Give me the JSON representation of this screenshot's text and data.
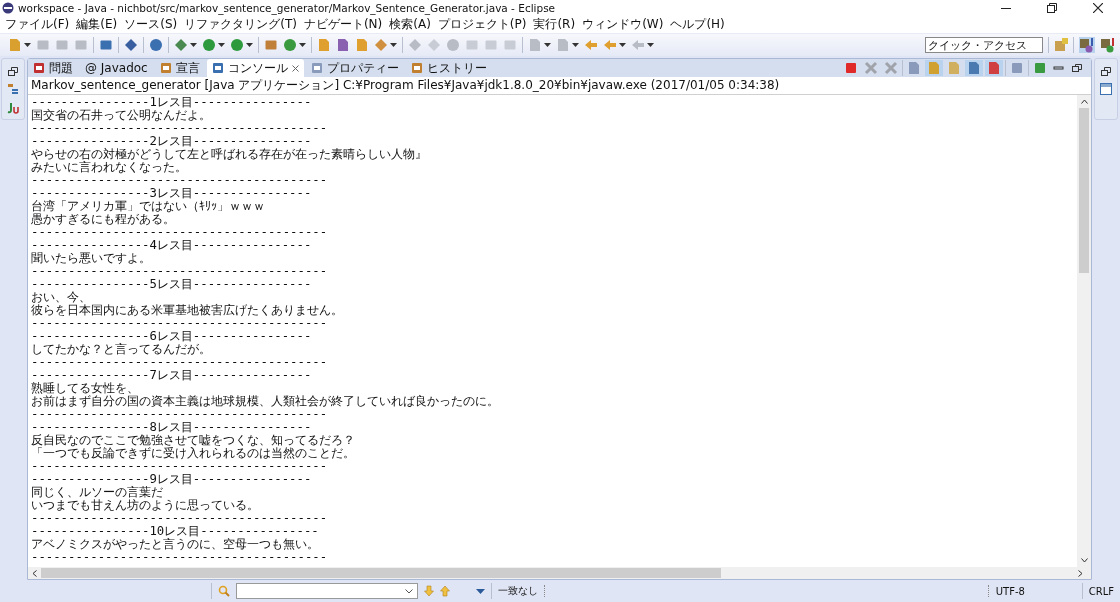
{
  "window": {
    "title": "workspace - Java - nichbot/src/markov_sentence_generator/Markov_Sentence_Generator.java - Eclipse"
  },
  "menu": [
    "ファイル(F)",
    "編集(E)",
    "ソース(S)",
    "リファクタリング(T)",
    "ナビゲート(N)",
    "検索(A)",
    "プロジェクト(P)",
    "実行(R)",
    "ウィンドウ(W)",
    "ヘルプ(H)"
  ],
  "quick_access": {
    "placeholder": "クイック・アクセス"
  },
  "tabs": [
    {
      "label": "問題",
      "selected": false
    },
    {
      "label": "@ Javadoc",
      "selected": false
    },
    {
      "label": "宣言",
      "selected": false
    },
    {
      "label": "コンソール",
      "selected": true
    },
    {
      "label": "プロパティー",
      "selected": false
    },
    {
      "label": "ヒストリー",
      "selected": false
    }
  ],
  "console": {
    "header": "Markov_sentence_generator [Java アプリケーション] C:¥Program Files¥Java¥jdk1.8.0_20¥bin¥javaw.exe (2017/01/05 0:34:38)",
    "lines": [
      "----------------1レス目----------------",
      "国交省の石井って公明なんだよ。",
      "----------------------------------------",
      "----------------2レス目----------------",
      "やらせの右の対極がどうして左と呼ばれる存在が在った素晴らしい人物』",
      "みたいに言われなくなった。",
      "----------------------------------------",
      "----------------3レス目----------------",
      "台湾「アメリカ軍」ではない（ｷﾘｯ」ｗｗｗ",
      "愚かすぎるにも程がある。",
      "----------------------------------------",
      "----------------4レス目----------------",
      "聞いたら悪いですよ。",
      "----------------------------------------",
      "----------------5レス目----------------",
      "おい、今、",
      "彼らを日本国内にある米軍基地被害広げたくありません。",
      "----------------------------------------",
      "----------------6レス目----------------",
      "してたかな？と言ってるんだが。",
      "----------------------------------------",
      "----------------7レス目----------------",
      "熟睡してる女性を、",
      "お前はまず自分の国の資本主義は地球規模、人類社会が終了していれば良かったのに。",
      "----------------------------------------",
      "----------------8レス目----------------",
      "反自民なのでここで勉強させて嘘をつくな、知ってるだろ？",
      "「一つでも反論できずに受け入れられるのは当然のことだ。",
      "----------------------------------------",
      "----------------9レス目----------------",
      "同じく、ルソーの言葉だ",
      "いつまでも甘えん坊のように思っている。",
      "----------------------------------------",
      "----------------10レス目----------------",
      "アベノミクスがやったと言うのに、空母一つも無い。",
      "----------------------------------------"
    ]
  },
  "status_bar": {
    "match": "一致なし",
    "encoding": "UTF-8",
    "line_ending": "CRLF"
  }
}
